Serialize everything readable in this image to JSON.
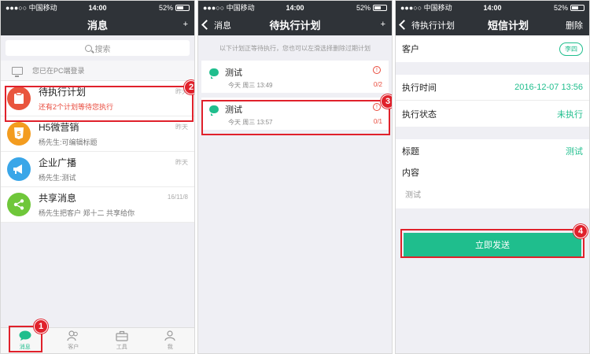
{
  "status": {
    "carrier": "●●●○○ 中国移动",
    "time": "14:00",
    "battery": "52%"
  },
  "screen1": {
    "title": "消息",
    "plus": "+",
    "search_placeholder": "搜索",
    "pc_login": "您已在PC端登录",
    "messages": [
      {
        "title": "待执行计划",
        "subtitle": "还有2个计划等待您执行",
        "time": "昨天",
        "color": "#e9553d"
      },
      {
        "title": "H5微营销",
        "subtitle": "杨先生:可编辑标题",
        "time": "昨天",
        "color": "#f39c1f"
      },
      {
        "title": "企业广播",
        "subtitle": "杨先生:测试",
        "time": "昨天",
        "color": "#3aa6e8"
      },
      {
        "title": "共享消息",
        "subtitle": "杨先生把客户 郑十二 共享给你",
        "time": "16/11/8",
        "color": "#6fc73a"
      }
    ],
    "tabs": [
      {
        "label": "消息"
      },
      {
        "label": "客户"
      },
      {
        "label": "工具"
      },
      {
        "label": "我"
      }
    ],
    "badges": {
      "one": "1",
      "two": "2"
    }
  },
  "screen2": {
    "back_label": "消息",
    "title": "待执行计划",
    "plus": "+",
    "hint": "以下计划正等待执行，您也可以左滑选择删除过期计划",
    "plans": [
      {
        "title": "测试",
        "meta": "今天   周三   13:49",
        "count": "0/2",
        "alert": "!"
      },
      {
        "title": "测试",
        "meta": "今天   周三   13:57",
        "count": "0/1",
        "alert": "!"
      }
    ],
    "badge": "3"
  },
  "screen3": {
    "back_label": "待执行计划",
    "title": "短信计划",
    "delete_label": "删除",
    "client_label": "客户",
    "client_value": "李四",
    "exec_time_label": "执行时间",
    "exec_time_value": "2016-12-07 13:56",
    "exec_status_label": "执行状态",
    "exec_status_value": "未执行",
    "subject_label": "标题",
    "subject_value": "测试",
    "content_label": "内容",
    "content_value": "测试",
    "send_label": "立即发送",
    "badge": "4"
  }
}
